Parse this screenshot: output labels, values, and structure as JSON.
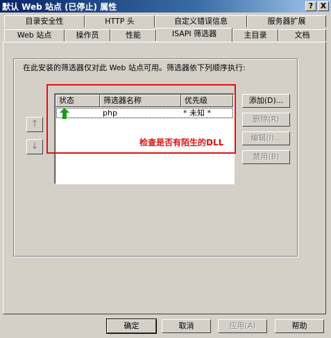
{
  "window": {
    "title": "默认 Web 站点 (已停止) 属性",
    "help_button": "?",
    "close_button": "X"
  },
  "tabs_row1": [
    "目录安全性",
    "HTTP 头",
    "自定义错误信息",
    "服务器扩展"
  ],
  "tabs_row2": [
    "Web 站点",
    "操作员",
    "性能",
    "ISAPI 筛选器",
    "主目录",
    "文档"
  ],
  "active_tab": "ISAPI 筛选器",
  "panel": {
    "description": "在此安装的筛选器仅对此 Web 站点可用。筛选器依下列顺序执行:",
    "move_up_label": "↑",
    "move_down_label": "↓",
    "columns": [
      "状态",
      "筛选器名称",
      "优先级"
    ],
    "rows": [
      {
        "status_icon": "green-up-arrow-icon",
        "name": "php",
        "priority": "* 未知 *"
      }
    ],
    "buttons": {
      "add": "添加(D)...",
      "remove": "删除(R)",
      "edit": "编辑(I)...",
      "disable": "禁用(B)"
    },
    "annotation": "检查是否有陌生的DLL",
    "annotation_color": "#e01010"
  },
  "footer": {
    "ok": "确定",
    "cancel": "取消",
    "apply": "应用(A)",
    "help": "帮助"
  }
}
